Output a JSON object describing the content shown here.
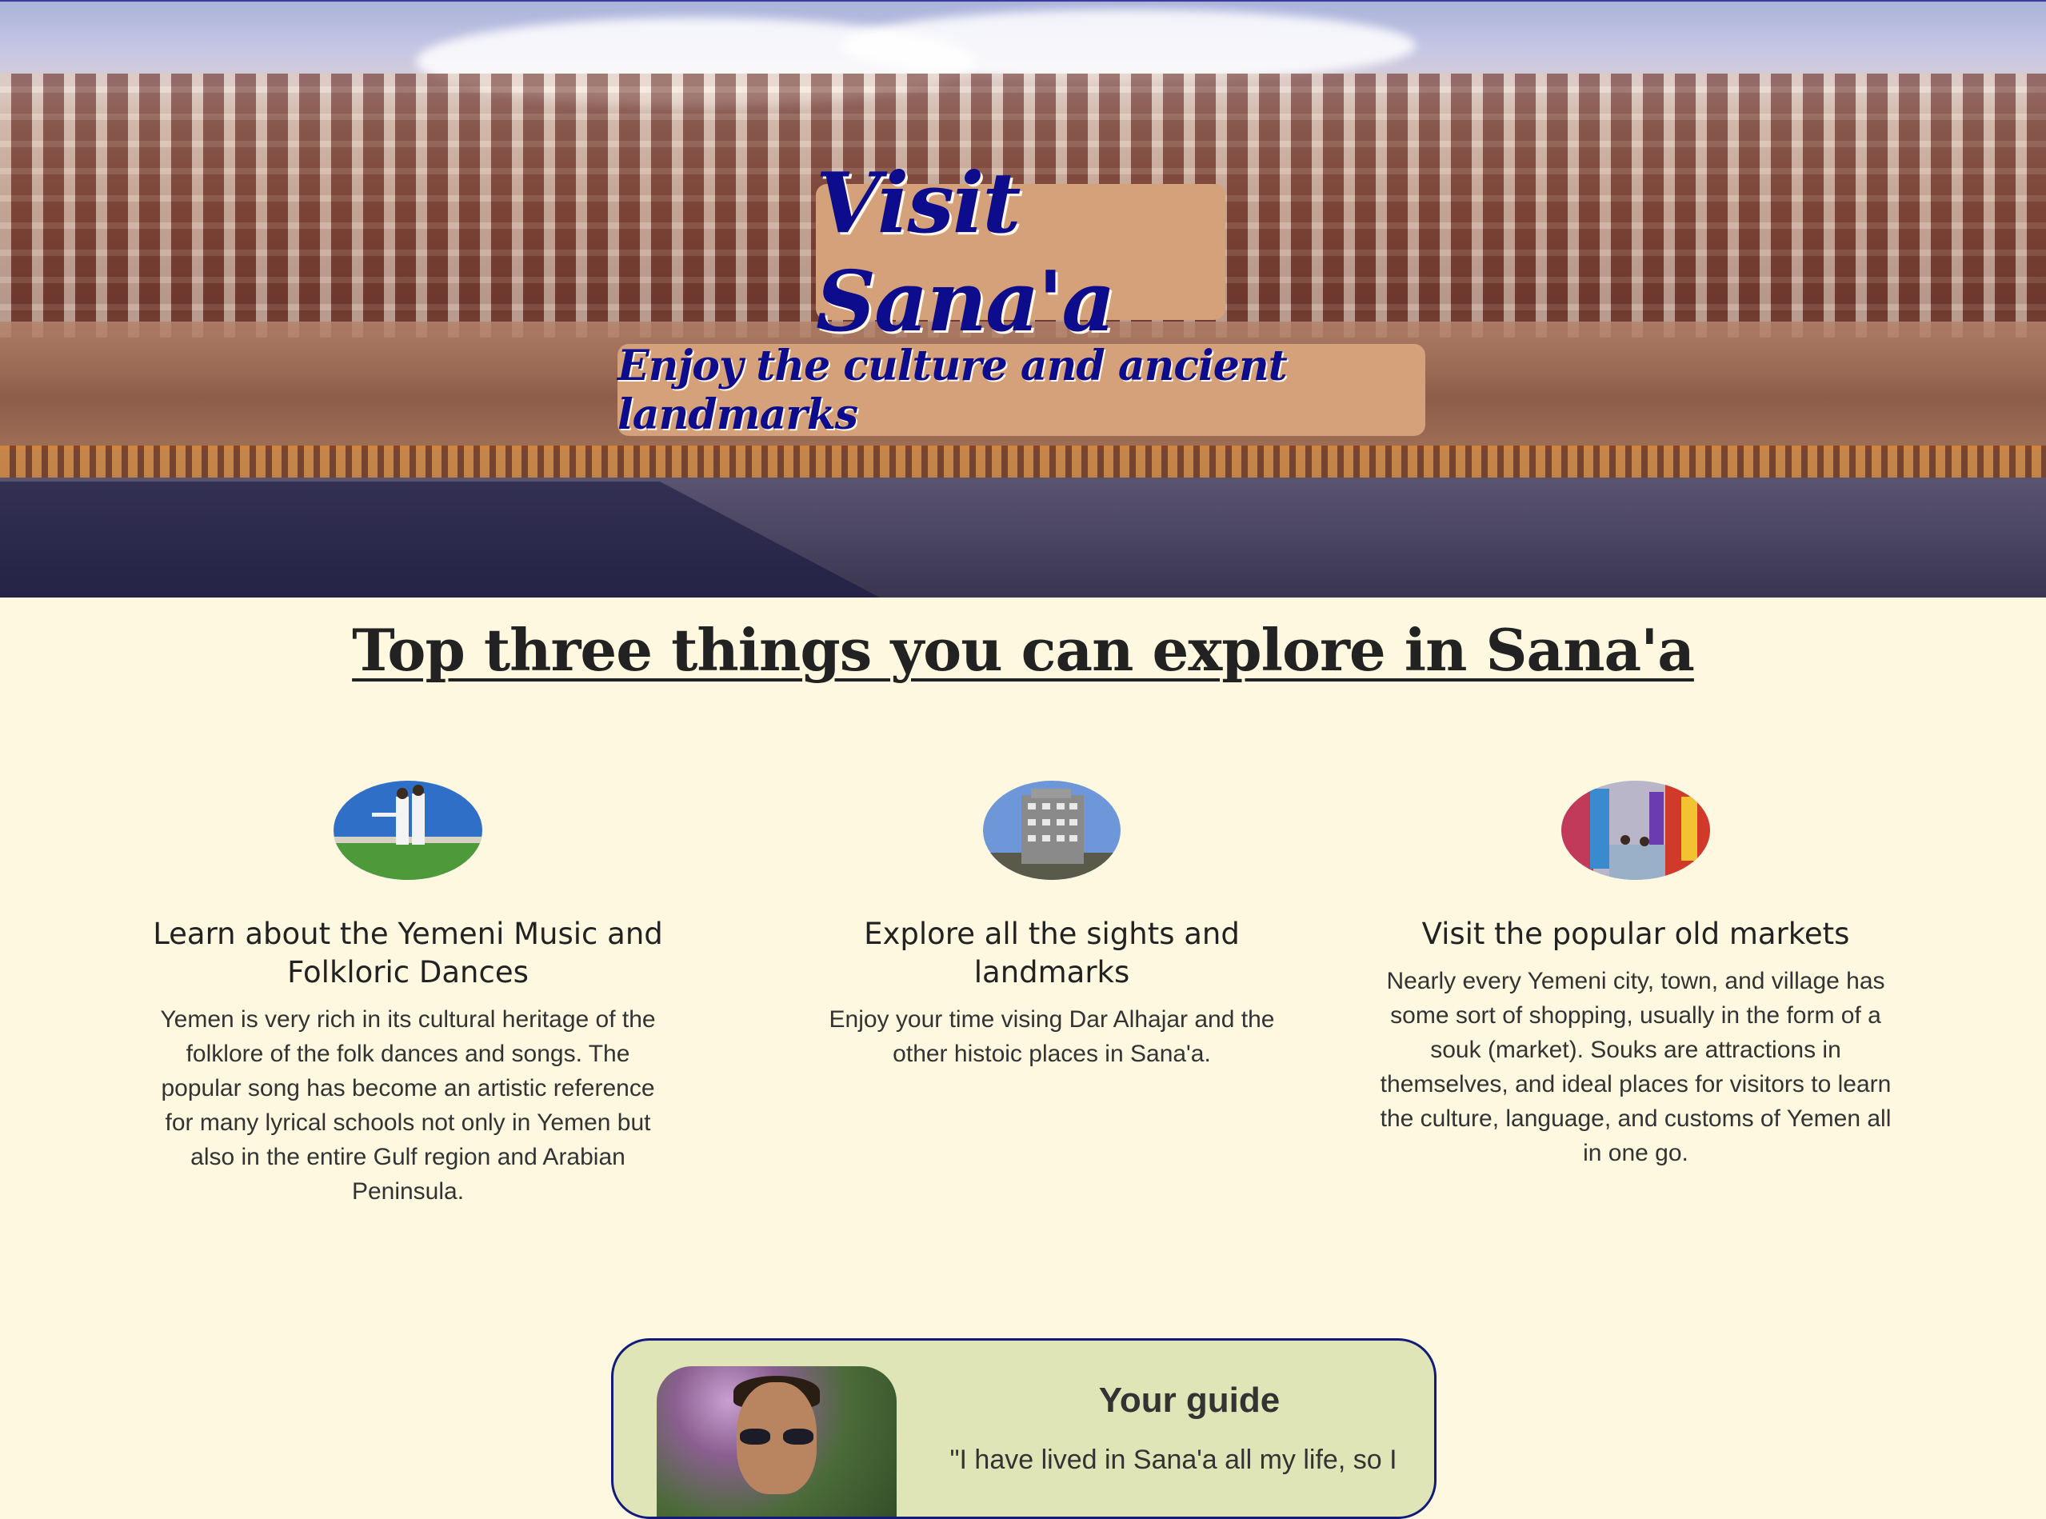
{
  "hero": {
    "title": "Visit Sana'a",
    "subtitle": "Enjoy the culture and ancient landmarks",
    "image": "old-sanaa-cityscape-photo"
  },
  "explore": {
    "heading": "Top three things you can explore in Sana'a",
    "items": [
      {
        "image": "folk-dancers-photo",
        "title": "Learn about the Yemeni Music and Folkloric Dances",
        "text": "Yemen is very rich in its cultural heritage of the folklore of the folk dances and songs. The popular song has become an artistic reference for many lyrical schools not only in Yemen but also in the entire Gulf region and Arabian Peninsula."
      },
      {
        "image": "dar-alhajar-photo",
        "title": "Explore all the sights and landmarks",
        "text": "Enjoy your time vising Dar Alhajar and the other histoic places in Sana'a."
      },
      {
        "image": "old-market-photo",
        "title": "Visit the popular old markets",
        "text": "Nearly every Yemeni city, town, and village has some sort of shopping, usually in the form of a souk (market). Souks are attractions in themselves, and ideal places for visitors to learn the culture, language, and customs of Yemen all in one go."
      }
    ]
  },
  "guide": {
    "title": "Your guide",
    "quote": "\"I have lived in Sana'a all my life, so I",
    "photo": "guide-portrait-photo"
  },
  "colors": {
    "background": "#fdf8df",
    "title_box": "#d4a17a",
    "title_text": "#0c0c8c",
    "guide_card": "#dfe5b7",
    "guide_border": "#121c78"
  }
}
